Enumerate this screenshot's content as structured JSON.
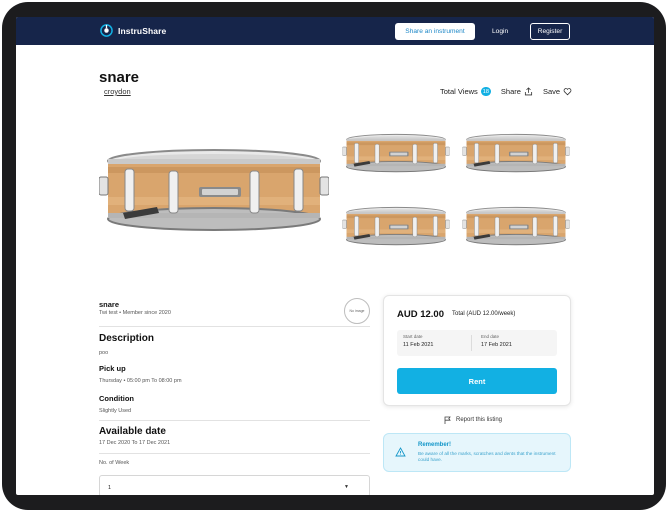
{
  "nav": {
    "brand": "InstruShare",
    "share_button": "Share an instrument",
    "login": "Login",
    "register": "Register"
  },
  "listing": {
    "title": "snare",
    "location": "croydon",
    "views_label": "Total Views",
    "views_count": "18",
    "share_label": "Share",
    "save_label": "Save"
  },
  "seller": {
    "name": "snare",
    "meta": "Twi test • Member since 2020",
    "avatar_text": "No image"
  },
  "details": {
    "description_heading": "Description",
    "description_text": "poo",
    "pickup_heading": "Pick up",
    "pickup_text": "Thursday • 05:00 pm To 08:00 pm",
    "condition_heading": "Condition",
    "condition_text": "Slightly Used",
    "availability_heading": "Available date",
    "availability_text": "17 Dec 2020 To 17 Dec 2021",
    "weeks_label": "No. of Week",
    "weeks_value": "1"
  },
  "booking": {
    "price": "AUD 12.00",
    "total": "Total (AUD 12.00/week)",
    "start_label": "Start date",
    "start_value": "11 Feb 2021",
    "end_label": "End date",
    "end_value": "17 Feb 2021",
    "rent_button": "Rent",
    "report": "Report this listing"
  },
  "reminder": {
    "title": "Remember!",
    "text": "Be aware of all the marks, scratches and dents that the instrument could have."
  },
  "colors": {
    "nav_bg": "#16254a",
    "accent": "#12b0e3",
    "reminder_bg": "#e6f6fc"
  },
  "icons": [
    "brand-logo-icon",
    "share-icon",
    "heart-icon",
    "flag-icon",
    "warning-icon",
    "chevron-down-icon"
  ]
}
